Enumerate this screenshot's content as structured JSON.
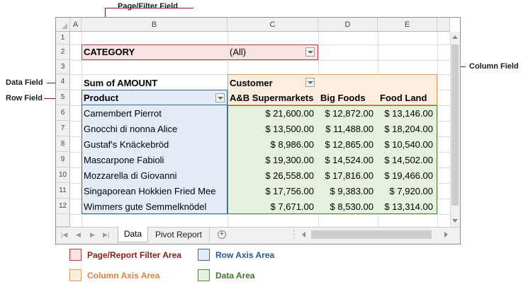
{
  "callouts": {
    "page_filter": "Page/Filter Field",
    "column_field": "Column Field",
    "data_field": "Data Field",
    "row_field": "Row Field"
  },
  "columns": [
    "A",
    "B",
    "C",
    "D",
    "E"
  ],
  "row_numbers": [
    "1",
    "2",
    "3",
    "4",
    "5",
    "6",
    "7",
    "8",
    "9",
    "10",
    "11",
    "12"
  ],
  "filter": {
    "label": "CATEGORY",
    "value": "(All)"
  },
  "pivot": {
    "data_field": "Sum of AMOUNT",
    "column_field": "Customer",
    "row_field": "Product",
    "column_headers": [
      "A&B Supermarkets",
      "Big Foods",
      "Food Land"
    ],
    "rows": [
      {
        "product": "Camembert Pierrot",
        "values": [
          "$ 21,600.00",
          "$ 12,872.00",
          "$ 13,146.00"
        ]
      },
      {
        "product": "Gnocchi di nonna Alice",
        "values": [
          "$ 13,500.00",
          "$ 11,488.00",
          "$ 18,204.00"
        ]
      },
      {
        "product": "Gustaf's Knäckebröd",
        "values": [
          "$ 8,986.00",
          "$ 12,865.00",
          "$ 10,540.00"
        ]
      },
      {
        "product": "Mascarpone Fabioli",
        "values": [
          "$ 19,300.00",
          "$ 14,524.00",
          "$ 14,502.00"
        ]
      },
      {
        "product": "Mozzarella di Giovanni",
        "values": [
          "$ 26,558.00",
          "$ 17,816.00",
          "$ 19,466.00"
        ]
      },
      {
        "product": "Singaporean Hokkien Fried Mee",
        "values": [
          "$ 17,756.00",
          "$ 9,383.00",
          "$ 7,920.00"
        ]
      },
      {
        "product": "Wimmers gute Semmelknödel",
        "values": [
          "$ 7,671.00",
          "$ 8,530.00",
          "$ 13,314.00"
        ]
      }
    ]
  },
  "tabs": [
    "Data",
    "Pivot Report"
  ],
  "active_tab": "Data",
  "legend": {
    "filter_area": "Page/Report Filter Area",
    "row_area": "Row Axis Area",
    "column_area": "Column Axis Area",
    "data_area": "Data Area"
  },
  "colors": {
    "filter_fill": "#fbe3e3",
    "filter_border": "#b04040",
    "row_fill": "#e3ecf7",
    "row_border": "#2f6aa5",
    "column_fill": "#fdeee0",
    "column_border": "#e39a5a",
    "data_fill": "#e7f1df",
    "data_border": "#4e8a3a",
    "callout": "#8b1a1a"
  }
}
